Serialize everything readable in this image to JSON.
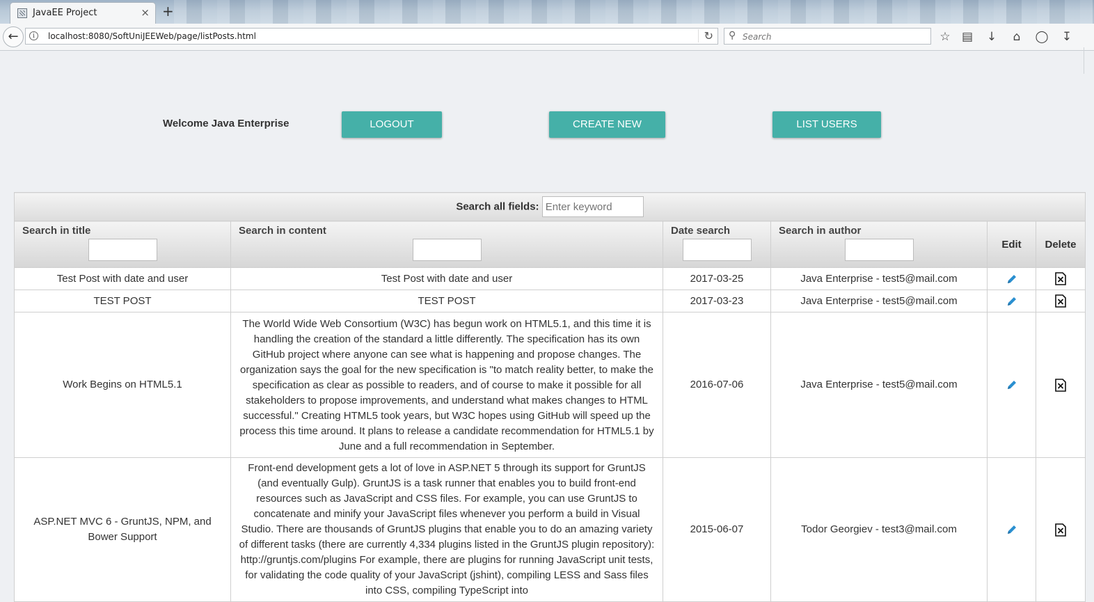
{
  "browser": {
    "tab_title": "JavaEE Project",
    "tab_close": "×",
    "new_tab": "+",
    "url": "localhost:8080/SoftUniJEEWeb/page/listPosts.html",
    "search_placeholder": "Search"
  },
  "header": {
    "welcome": "Welcome Java Enterprise",
    "logout_label": "LOGOUT",
    "create_label": "CREATE NEW",
    "list_users_label": "LIST USERS"
  },
  "filters": {
    "global_label": "Search all fields:",
    "global_placeholder": "Enter keyword"
  },
  "columns": {
    "title": "Search in title",
    "content": "Search in content",
    "date": "Date search",
    "author": "Search in author",
    "edit": "Edit",
    "delete": "Delete"
  },
  "rows": [
    {
      "title": "Test Post with date and user",
      "content": "Test Post with date and user",
      "date": "2017-03-25",
      "author": "Java Enterprise - test5@mail.com"
    },
    {
      "title": "TEST POST",
      "content": "TEST POST",
      "date": "2017-03-23",
      "author": "Java Enterprise - test5@mail.com"
    },
    {
      "title": "Work Begins on HTML5.1",
      "content": "The World Wide Web Consortium (W3C) has begun work on HTML5.1, and this time it is handling the creation of the standard a little differently. The specification has its own GitHub project where anyone can see what is happening and propose changes. The organization says the goal for the new specification is \"to match reality better, to make the specification as clear as possible to readers, and of course to make it possible for all stakeholders to propose improvements, and understand what makes changes to HTML successful.\" Creating HTML5 took years, but W3C hopes using GitHub will speed up the process this time around. It plans to release a candidate recommendation for HTML5.1 by June and a full recommendation in September.",
      "date": "2016-07-06",
      "author": "Java Enterprise - test5@mail.com"
    },
    {
      "title": "ASP.NET MVC 6 - GruntJS, NPM, and Bower Support",
      "content": "Front-end development gets a lot of love in ASP.NET 5 through its support for GruntJS (and eventually Gulp). GruntJS is a task runner that enables you to build front-end resources such as JavaScript and CSS files. For example, you can use GruntJS to concatenate and minify your JavaScript files whenever you perform a build in Visual Studio. There are thousands of GruntJS plugins that enable you to do an amazing variety of different tasks (there are currently 4,334 plugins listed in the GruntJS plugin repository): http://gruntjs.com/plugins For example, there are plugins for running JavaScript unit tests, for validating the code quality of your JavaScript (jshint), compiling LESS and Sass files into CSS, compiling TypeScript into",
      "date": "2015-06-07",
      "author": "Todor Georgiev - test3@mail.com"
    }
  ],
  "icons": {
    "edit": "pencil-icon",
    "delete": "delete-x-icon",
    "accent": "#45b0a8",
    "edit_color": "#2a8fd0"
  }
}
